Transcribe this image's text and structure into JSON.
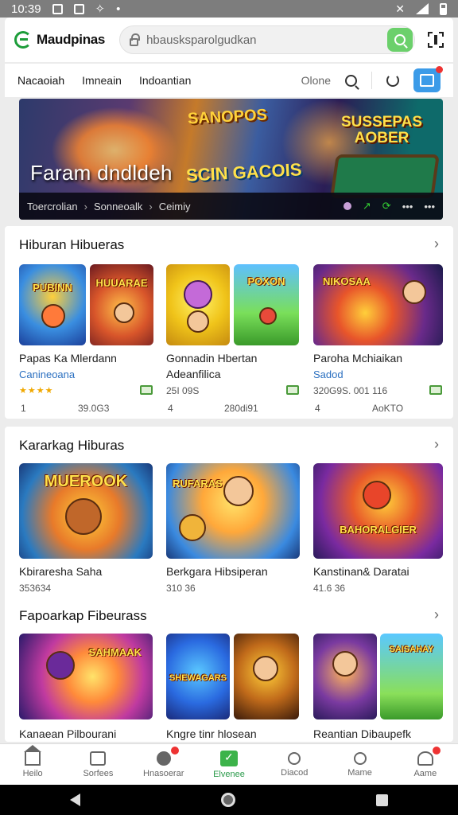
{
  "status_bar": {
    "time": "10:39"
  },
  "app": {
    "brand_name": "Maudpinas",
    "search_placeholder": "hbausksparolgudkan"
  },
  "tabs": {
    "items": [
      "Nacaoiah",
      "Imneain",
      "Indoantian"
    ],
    "online_label": "Olone"
  },
  "banner": {
    "caption": "Faram dndldeh",
    "logo1": "SANOPOS",
    "logo2": "SCIN GACOIS",
    "logo3_line1": "SUSSEPAS",
    "logo3_line2": "AOBER",
    "crumbs": [
      "Toercrolian",
      "Sonneoalk",
      "Ceimiy"
    ]
  },
  "section1": {
    "title": "Hiburan Hibueras",
    "games": [
      {
        "title": "Papas Ka Mlerdann",
        "subtitle": "Canineoana",
        "stars": "★★★★",
        "meta_left": "1",
        "meta_right": "39.0G3",
        "tile_label_a": "PUBINN",
        "tile_label_b": "HUUARAE"
      },
      {
        "title": "Gonnadin Hbertan",
        "subtitle": "Adeanfilica",
        "stars": "",
        "meta_top": "25I 09S",
        "meta_left": "4",
        "meta_right": "280di91",
        "tile_label_a": "",
        "tile_label_b": "POXON"
      },
      {
        "title": "Paroha Mchiaikan",
        "subtitle": "Sadod",
        "stars": "",
        "meta_top": "320G9S.   001 116",
        "meta_left": "4",
        "meta_right": "AoKTO",
        "tile_label_a": "NIKOSAA",
        "tile_label_b": ""
      }
    ]
  },
  "section2": {
    "title": "Kararkag Hiburas",
    "games": [
      {
        "title": "Kbiraresha Saha",
        "meta": "353634",
        "tile_label": "MUEROOK"
      },
      {
        "title": "Berkgara Hibsiperan",
        "meta": "310 36",
        "tile_label": "RUFARAS"
      },
      {
        "title": "Kanstinan& Daratai",
        "meta": "41.6 36",
        "tile_label": "BAHORALGIER"
      }
    ]
  },
  "section3": {
    "title": "Fapoarkap Fibeurass",
    "games": [
      {
        "title": "Kanaean Pilbourani",
        "tile_label": "SAHMAAK"
      },
      {
        "title": "Kngre tinr hlosean",
        "tile_label": "SHEWAGARS"
      },
      {
        "title": "Reantian Dibaupefk",
        "tile_label": "SAISAHAY"
      }
    ]
  },
  "bottom_nav": [
    {
      "label": "Heilo",
      "icon": "home-icon",
      "badge": false,
      "active": false
    },
    {
      "label": "Sorfees",
      "icon": "chat-icon",
      "badge": false,
      "active": false
    },
    {
      "label": "Hnasoerar",
      "icon": "heart-icon",
      "badge": true,
      "active": false
    },
    {
      "label": "Elvenee",
      "icon": "active-check-icon",
      "badge": false,
      "active": true
    },
    {
      "label": "Diacod",
      "icon": "search-user-icon",
      "badge": false,
      "active": false
    },
    {
      "label": "Mame",
      "icon": "search-icon",
      "badge": false,
      "active": false
    },
    {
      "label": "Aame",
      "icon": "user-icon",
      "badge": true,
      "active": false
    }
  ]
}
